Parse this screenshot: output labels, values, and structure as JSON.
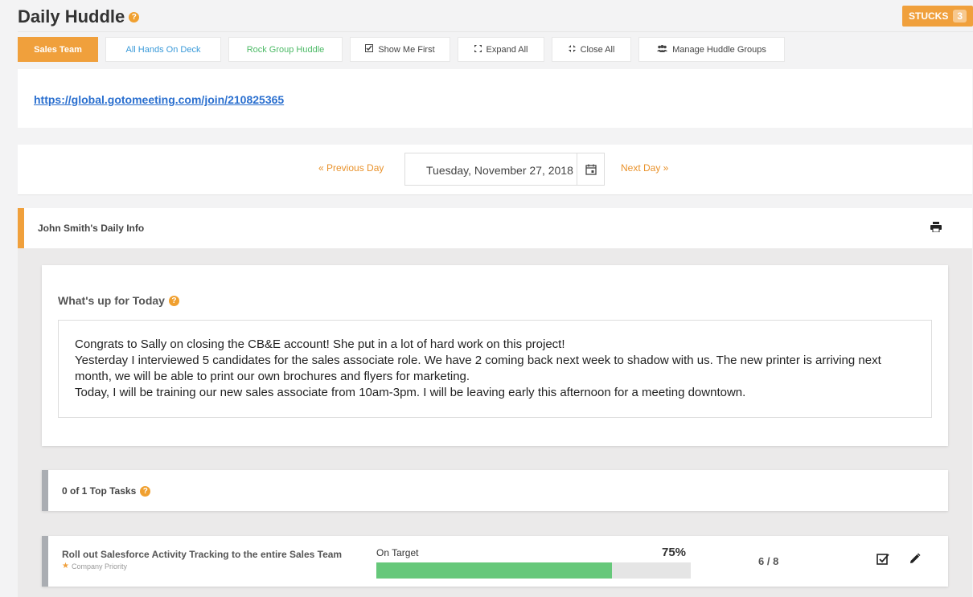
{
  "header": {
    "title": "Daily Huddle",
    "help_icon": "?"
  },
  "stucks": {
    "label": "STUCKS",
    "count": "3"
  },
  "tabs": [
    {
      "label": "Sales Team",
      "active": true
    },
    {
      "label": "All Hands On Deck"
    },
    {
      "label": "Rock Group Huddle"
    },
    {
      "label": "Show Me First",
      "icon": "checkbox-icon"
    },
    {
      "label": "Expand All",
      "icon": "expand-icon"
    },
    {
      "label": "Close All",
      "icon": "collapse-icon"
    },
    {
      "label": "Manage Huddle Groups",
      "icon": "users-icon"
    }
  ],
  "meeting": {
    "url": "https://global.gotomeeting.com/join/210825365"
  },
  "date_nav": {
    "prev_label": "« Previous Day",
    "next_label": "Next Day »",
    "date": "Tuesday, November 27, 2018"
  },
  "daily": {
    "title": "John Smith's Daily Info",
    "today_heading": "What's up for Today",
    "today_lines": [
      "Congrats to Sally on closing the CB&E account! She put in a lot of hard work on this project!",
      "Yesterday I interviewed 5 candidates for the sales associate role. We have 2 coming back next week to shadow with us. The new printer is arriving next month, we will be able to print our own brochures and flyers for marketing.",
      "Today, I will be training our new sales associate from 10am-3pm. I will be leaving early this afternoon for a meeting downtown."
    ],
    "top_tasks_label": "0 of 1 Top Tasks",
    "task": {
      "title": "Roll out Salesforce Activity Tracking to the entire Sales Team",
      "priority": "Company Priority",
      "status": "On Target",
      "percent_label": "75%",
      "progress": 0.75,
      "ratio": "6 / 8"
    }
  },
  "colors": {
    "accent": "#f0a03c",
    "progress": "#66c87a",
    "link": "#2a6fcf"
  }
}
